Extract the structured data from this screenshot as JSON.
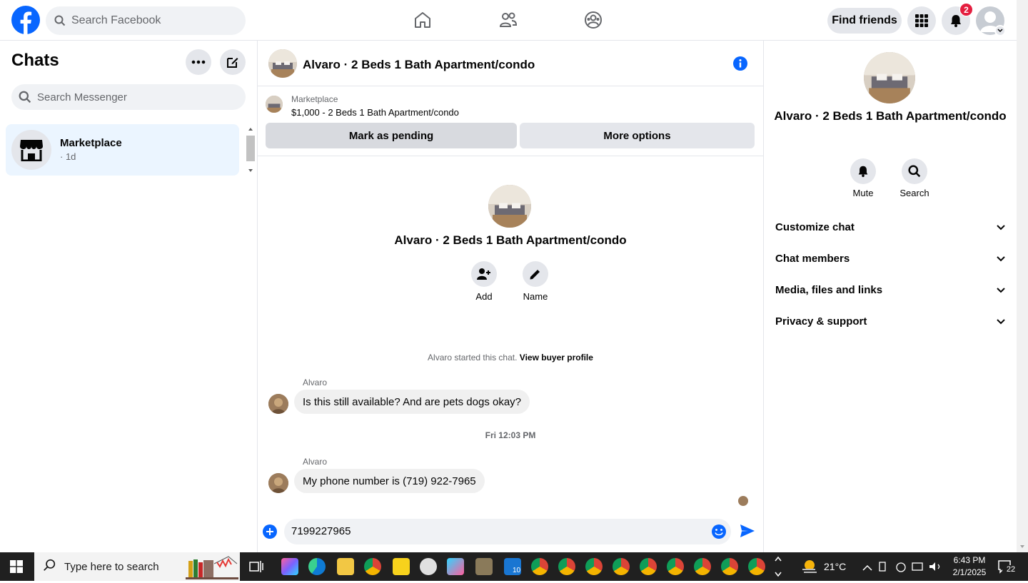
{
  "topbar": {
    "search_placeholder": "Search Facebook",
    "find_friends": "Find friends",
    "notification_count": "2"
  },
  "sidebar": {
    "title": "Chats",
    "search_placeholder": "Search Messenger",
    "chats": [
      {
        "name": "Marketplace",
        "time": "· 1d"
      }
    ]
  },
  "conversation": {
    "title": "Alvaro · 2 Beds 1 Bath Apartment/condo",
    "marketplace_label": "Marketplace",
    "listing": "$1,000 - 2 Beds 1 Bath Apartment/condo",
    "mark_pending": "Mark as pending",
    "more_options": "More options",
    "center_name": "Alvaro · 2 Beds 1 Bath Apartment/condo",
    "add_label": "Add",
    "name_label": "Name",
    "started_text": "Alvaro started this chat. ",
    "view_buyer": "View buyer profile",
    "messages": [
      {
        "sender": "Alvaro",
        "text": "Is this still available? And are pets dogs okay?"
      },
      {
        "sender": "Alvaro",
        "text": "My phone number is (719) 922-7965"
      }
    ],
    "timestamp": "Fri 12:03 PM",
    "compose_value": "7199227965"
  },
  "details": {
    "name": "Alvaro · 2 Beds 1 Bath Apartment/condo",
    "mute": "Mute",
    "search": "Search",
    "sections": [
      "Customize chat",
      "Chat members",
      "Media, files and links",
      "Privacy & support"
    ]
  },
  "taskbar": {
    "search_placeholder": "Type here to search",
    "outlook_badge": "10",
    "weather": "21°C",
    "time": "6:43 PM",
    "date": "2/1/2025",
    "notif_count": "22"
  },
  "colors": {
    "brand": "#0866ff",
    "badge": "#e41e3f",
    "selected": "#ebf5ff"
  }
}
